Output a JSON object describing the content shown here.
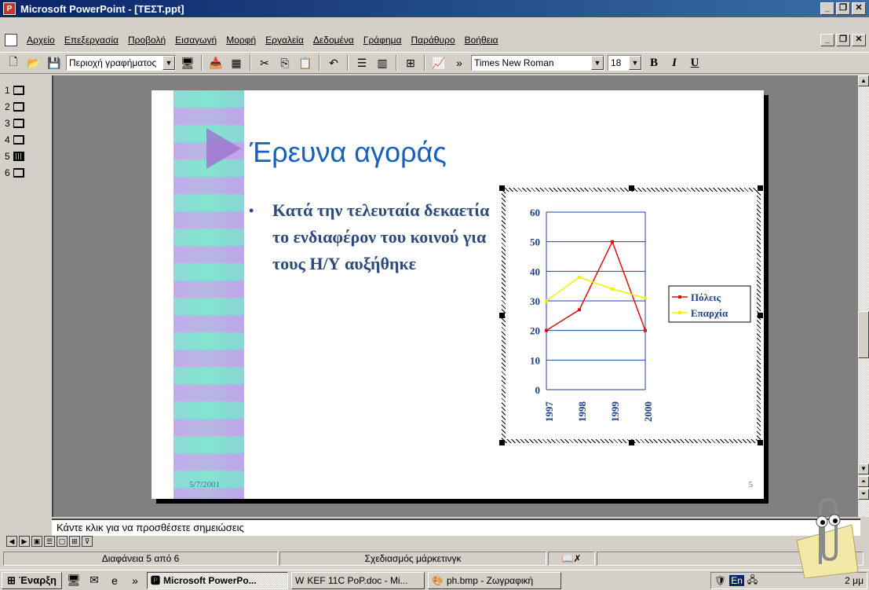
{
  "window": {
    "title": "Microsoft PowerPoint - [ΤΕΣΤ.ppt]"
  },
  "menu": [
    "Αρχείο",
    "Επεξεργασία",
    "Προβολή",
    "Εισαγωγή",
    "Μορφή",
    "Εργαλεία",
    "Δεδομένα",
    "Γράφημα",
    "Παράθυρο",
    "Βοήθεια"
  ],
  "toolbar": {
    "object_combo": "Περιοχή γραφήματος",
    "font": "Times New Roman",
    "size": "18",
    "bold": "B",
    "italic": "I",
    "underline": "U"
  },
  "outline": [
    "1",
    "2",
    "3",
    "4",
    "5",
    "6"
  ],
  "slide": {
    "title": "Έρευνα αγοράς",
    "bullet": "Κατά την τελευταία δεκαετία το ενδιαφέρον του κοινού για τους Η/Υ αυξήθηκε",
    "date": "5/7/2001",
    "number": "5"
  },
  "chart_data": {
    "type": "line",
    "categories": [
      "1997",
      "1998",
      "1999",
      "2000"
    ],
    "series": [
      {
        "name": "Πόλεις",
        "values": [
          20,
          27,
          50,
          20
        ],
        "color": "#e01010"
      },
      {
        "name": "Επαρχία",
        "values": [
          30,
          38,
          34,
          31
        ],
        "color": "#f5f000"
      }
    ],
    "ylim": [
      0,
      60
    ],
    "yticks": [
      "0",
      "10",
      "20",
      "30",
      "40",
      "50",
      "60"
    ],
    "grid": true,
    "legend": "right"
  },
  "notes": {
    "text": "Κάντε κλικ για να προσθέσετε σημειώσεις"
  },
  "status": {
    "slide": "Διαφάνεια 5 από 6",
    "design": "Σχεδιασμός μάρκετινγκ"
  },
  "taskbar": {
    "start": "Έναρξη",
    "items": [
      "Microsoft PowerPo...",
      "KEF 11C PoP.doc - Mi...",
      "ph.bmp - Ζωγραφική"
    ],
    "tray_lang": "En",
    "clock": "2 μμ"
  }
}
